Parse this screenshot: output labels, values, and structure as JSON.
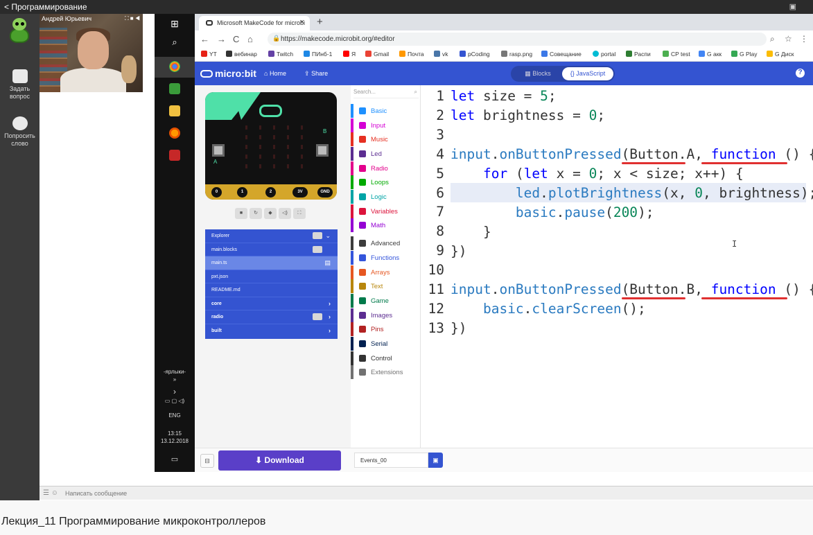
{
  "topbar": {
    "title": "Программирование",
    "fullscreen_icon": "fullscreen-icon"
  },
  "leftcol": {
    "ask_question": "Задать вопрос",
    "request_word": "Попросить слово"
  },
  "webcam": {
    "name": "Андрей Юрьевич",
    "controls": "⛶ ■ ◀"
  },
  "taskbar": {
    "shortcuts_label": "-ярлыки-",
    "shortcuts_arrow": "»",
    "lang": "ENG",
    "time": "13:15",
    "date": "13.12.2018"
  },
  "browser": {
    "tab_title": "Microsoft MakeCode for microbi",
    "url": "https://makecode.microbit.org/#editor",
    "bookmarks": [
      "YT",
      "вебинар",
      "Twitch",
      "ПИнб-1",
      "Я",
      "Gmail",
      "Почта",
      "vk",
      "pCoding",
      "rasp.png",
      "Совещание",
      "portal",
      "Распи",
      "CP test",
      "G акк",
      "G Play",
      "G Диск"
    ]
  },
  "makecode": {
    "logo": "micro:bit",
    "home": "Home",
    "share": "Share",
    "blocks": "Blocks",
    "javascript": "{} JavaScript",
    "help": "?"
  },
  "explorer": {
    "items": [
      "Explorer",
      "main.blocks",
      "main.ts",
      "pxt.json",
      "README.md",
      "core",
      "radio",
      "built"
    ]
  },
  "toolbox": {
    "search_placeholder": "Search...",
    "categories": [
      {
        "label": "Basic",
        "color": "#1e90ff"
      },
      {
        "label": "Input",
        "color": "#d400d4"
      },
      {
        "label": "Music",
        "color": "#e63022"
      },
      {
        "label": "Led",
        "color": "#5c2d91"
      },
      {
        "label": "Radio",
        "color": "#e3008c"
      },
      {
        "label": "Loops",
        "color": "#00aa00"
      },
      {
        "label": "Logic",
        "color": "#00a4a6"
      },
      {
        "label": "Variables",
        "color": "#dc143c"
      },
      {
        "label": "Math",
        "color": "#9400d3"
      },
      {
        "label": "Advanced",
        "color": "#3c3c3c"
      },
      {
        "label": "Functions",
        "color": "#3455db"
      },
      {
        "label": "Arrays",
        "color": "#e65722"
      },
      {
        "label": "Text",
        "color": "#b8860b"
      },
      {
        "label": "Game",
        "color": "#007a4b"
      },
      {
        "label": "Images",
        "color": "#5c2d91"
      },
      {
        "label": "Pins",
        "color": "#b22222"
      },
      {
        "label": "Serial",
        "color": "#002050"
      },
      {
        "label": "Control",
        "color": "#333333"
      },
      {
        "label": "Extensions",
        "color": "#717171"
      }
    ]
  },
  "simulator": {
    "pins": [
      "0",
      "1",
      "2",
      "3V",
      "GND"
    ],
    "button_a": "A",
    "button_b": "B"
  },
  "editor": {
    "lines": [
      {
        "n": "1"
      },
      {
        "n": "2"
      },
      {
        "n": "3"
      },
      {
        "n": "4"
      },
      {
        "n": "5"
      },
      {
        "n": "6"
      },
      {
        "n": "7"
      },
      {
        "n": "8"
      },
      {
        "n": "9"
      },
      {
        "n": "10"
      },
      {
        "n": "11"
      },
      {
        "n": "12"
      },
      {
        "n": "13"
      }
    ]
  },
  "bottombar": {
    "download": "Download",
    "project_name": "Events_00"
  },
  "chat": {
    "placeholder": "Написать сообщение"
  },
  "caption": "Лекция_11 Программирование микроконтроллеров"
}
